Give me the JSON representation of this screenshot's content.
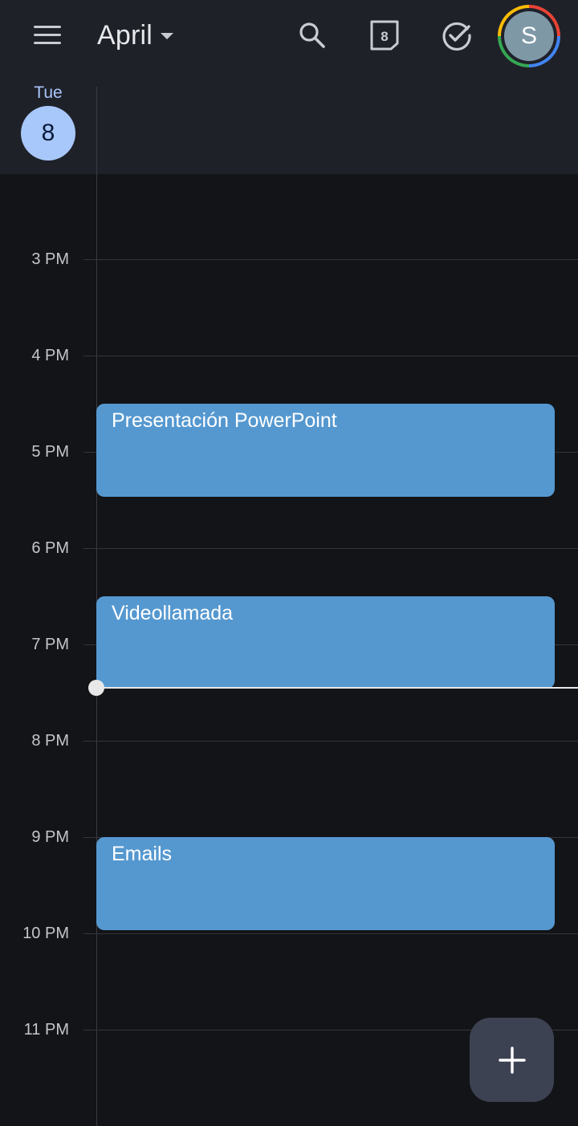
{
  "header": {
    "month": "April",
    "today_badge": "8",
    "avatar_initial": "S"
  },
  "day": {
    "name": "Tue",
    "number": "8"
  },
  "hours": [
    "3 PM",
    "4 PM",
    "5 PM",
    "6 PM",
    "7 PM",
    "8 PM",
    "9 PM",
    "10 PM",
    "11 PM"
  ],
  "events": [
    {
      "title": "Presentación PowerPoint",
      "color": "#5598d0"
    },
    {
      "title": "Videollamada",
      "color": "#5598d0"
    },
    {
      "title": "Emails",
      "color": "#5598d0"
    }
  ],
  "icons": {
    "menu": "menu-icon",
    "month_caret": "caret-down-icon",
    "search": "search-icon",
    "today": "calendar-today-icon",
    "tasks": "check-circle-icon",
    "create": "plus-icon"
  },
  "colors": {
    "accent": "#a8c7fa",
    "event": "#5598d0",
    "fab": "#3d4253"
  }
}
